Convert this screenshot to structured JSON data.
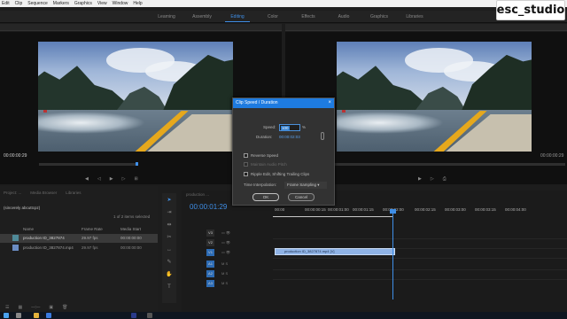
{
  "menu": [
    "Edit",
    "Clip",
    "Sequence",
    "Markers",
    "Graphics",
    "View",
    "Window",
    "Help"
  ],
  "workspaces": [
    {
      "label": "Learning",
      "active": false
    },
    {
      "label": "Assembly",
      "active": false
    },
    {
      "label": "Editing",
      "active": true
    },
    {
      "label": "Color",
      "active": false
    },
    {
      "label": "Effects",
      "active": false
    },
    {
      "label": "Audio",
      "active": false
    },
    {
      "label": "Graphics",
      "active": false
    },
    {
      "label": "Libraries",
      "active": false
    }
  ],
  "watermark": "esc_studio",
  "source_monitor": {
    "timecode": "00:00:00:29"
  },
  "program_monitor": {
    "timecode": "00:00:00:29"
  },
  "dialog": {
    "title": "Clip Speed / Duration",
    "speed_label": "Speed:",
    "speed_value": "100",
    "speed_unit": "%",
    "duration_label": "Duration:",
    "duration_value": "00:00:02:03",
    "reverse_speed": "Reverse Speed",
    "maintain_pitch": "Maintain Audio Pitch",
    "ripple_edit": "Ripple Edit, Shifting Trailing Clips",
    "interp_label": "Time Interpolation:",
    "interp_value": "Frame Sampling",
    "ok": "OK",
    "cancel": "Cancel"
  },
  "project": {
    "tabs": [
      "Project: ...",
      "Media Browser",
      "Libraries"
    ],
    "path": "(sincerely abcuttcpz)",
    "selection_count": "1 of 2 items selected",
    "columns": [
      "Name",
      "Frame Rate",
      "Media Start"
    ],
    "rows": [
      {
        "name": "production ID_3827874",
        "fps": "29.97 fps",
        "start": "00:00:00:00",
        "selected": true
      },
      {
        "name": "production ID_3827874.mp4",
        "fps": "29.97 fps",
        "start": "00:00:00:00",
        "selected": false
      }
    ]
  },
  "timeline": {
    "tab": "production ...",
    "timecode": "00:00:01:29",
    "ruler": [
      "00:00",
      "00:00:00:15",
      "00:00:01:00",
      "00:00:01:15",
      "00:00:02:00",
      "00:00:02:15",
      "00:00:03:00",
      "00:00:03:15",
      "00:00:04:00"
    ],
    "tracks": [
      "V3",
      "V2",
      "V1",
      "A1",
      "A2",
      "A3"
    ],
    "clip_label": "production ID_3827874.mp4 [V]"
  }
}
